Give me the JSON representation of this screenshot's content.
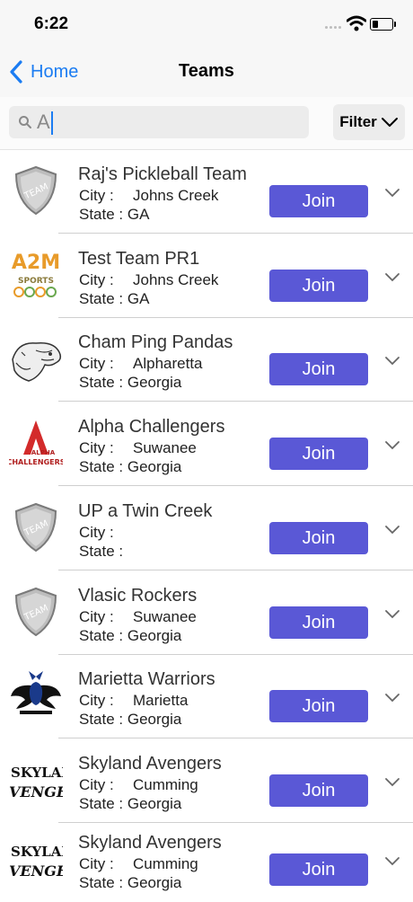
{
  "status_bar": {
    "time": "6:22"
  },
  "nav": {
    "back_label": "Home",
    "title": "Teams"
  },
  "search": {
    "value": "A"
  },
  "filter": {
    "label": "Filter"
  },
  "labels": {
    "city": "City :",
    "state": "State :"
  },
  "teams": [
    {
      "name": "Raj's Pickleball Team",
      "city": "Johns Creek",
      "state": "GA",
      "join_label": "Join",
      "logo": "team-shield-logo"
    },
    {
      "name": "Test Team PR1",
      "city": "Johns Creek",
      "state": "GA",
      "join_label": "Join",
      "logo": "a2m-sports-logo",
      "logo_text": "A2M",
      "logo_subtext": "SPORTS"
    },
    {
      "name": "Cham Ping Pandas",
      "city": "Alpharetta",
      "state": "Georgia",
      "join_label": "Join",
      "logo": "sketch-animal-logo"
    },
    {
      "name": "Alpha Challengers",
      "city": "Suwanee",
      "state": "Georgia",
      "join_label": "Join",
      "logo": "alpha-challengers-logo",
      "logo_text": "ALPHA",
      "logo_subtext": "CHALLENGERS"
    },
    {
      "name": "UP a Twin Creek",
      "city": "",
      "state": "",
      "join_label": "Join",
      "logo": "team-shield-logo"
    },
    {
      "name": "Vlasic Rockers",
      "city": "Suwanee",
      "state": "Georgia",
      "join_label": "Join",
      "logo": "team-shield-logo"
    },
    {
      "name": "Marietta Warriors",
      "city": "Marietta",
      "state": "Georgia",
      "join_label": "Join",
      "logo": "spartan-wings-logo"
    },
    {
      "name": "Skyland Avengers",
      "city": "Cumming",
      "state": "Georgia",
      "join_label": "Join",
      "logo": "skyland-avengers-logo",
      "logo_text": "SKYLAN",
      "logo_subtext": "VENGER"
    },
    {
      "name": "Skyland Avengers",
      "city": "Cumming",
      "state": "Georgia",
      "join_label": "Join",
      "logo": "skyland-avengers-logo",
      "logo_text": "SKYLAN",
      "logo_subtext": "VENGER"
    }
  ],
  "colors": {
    "accent": "#1b7cf2",
    "join_button": "#5a58d6"
  }
}
